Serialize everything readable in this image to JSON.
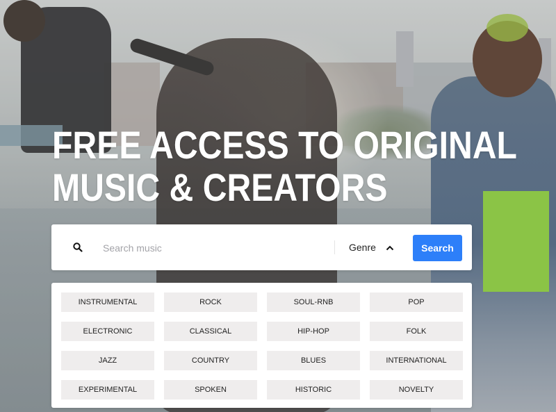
{
  "hero": {
    "headline_line1": "FREE ACCESS TO ORIGINAL",
    "headline_line2": "MUSIC & CREATORS",
    "background": "photo of musicians performing on a rooftop"
  },
  "search": {
    "icon": "search-icon",
    "placeholder": "Search music",
    "value": "",
    "genre_label": "Genre",
    "genre_icon": "chevron-up-icon",
    "button_label": "Search",
    "button_color": "#2d7ff9"
  },
  "genres": [
    {
      "label": "INSTRUMENTAL"
    },
    {
      "label": "ROCK"
    },
    {
      "label": "SOUL-RNB"
    },
    {
      "label": "POP"
    },
    {
      "label": "ELECTRONIC"
    },
    {
      "label": "CLASSICAL"
    },
    {
      "label": "HIP-HOP"
    },
    {
      "label": "FOLK"
    },
    {
      "label": "JAZZ"
    },
    {
      "label": "COUNTRY"
    },
    {
      "label": "BLUES"
    },
    {
      "label": "INTERNATIONAL"
    },
    {
      "label": "EXPERIMENTAL"
    },
    {
      "label": "SPOKEN"
    },
    {
      "label": "HISTORIC"
    },
    {
      "label": "NOVELTY"
    }
  ],
  "colors": {
    "chip_background": "#efeded",
    "panel_background": "#ffffff",
    "headline_color": "#ffffff"
  }
}
